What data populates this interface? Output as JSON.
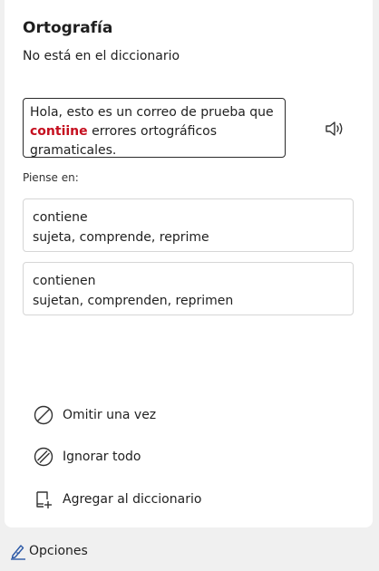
{
  "pane": {
    "title": "Ortografía",
    "subtitle": "No está en el diccionario"
  },
  "context": {
    "before": "Hola, esto es un correo de prueba que ",
    "error_word": "contiine",
    "after": " errores ortográficos gramaticales.",
    "error_color": "#c50f1f"
  },
  "suggestions": {
    "header": "Piense en:",
    "items": [
      {
        "word": "contiene",
        "synonyms": "sujeta, comprende, reprime"
      },
      {
        "word": "contienen",
        "synonyms": "sujetan, comprenden, reprimen"
      }
    ]
  },
  "actions": {
    "ignore_once": "Omitir una vez",
    "ignore_all": "Ignorar todo",
    "add_to_dictionary": "Agregar al diccionario"
  },
  "footer": {
    "options": "Opciones",
    "accent": "#2b58a6"
  },
  "icons": {
    "speaker": "speaker-icon",
    "ignore_once": "circle-slash-icon",
    "ignore_all": "double-circle-slash-icon",
    "add": "dictionary-add-icon",
    "options": "pen-lines-icon"
  }
}
